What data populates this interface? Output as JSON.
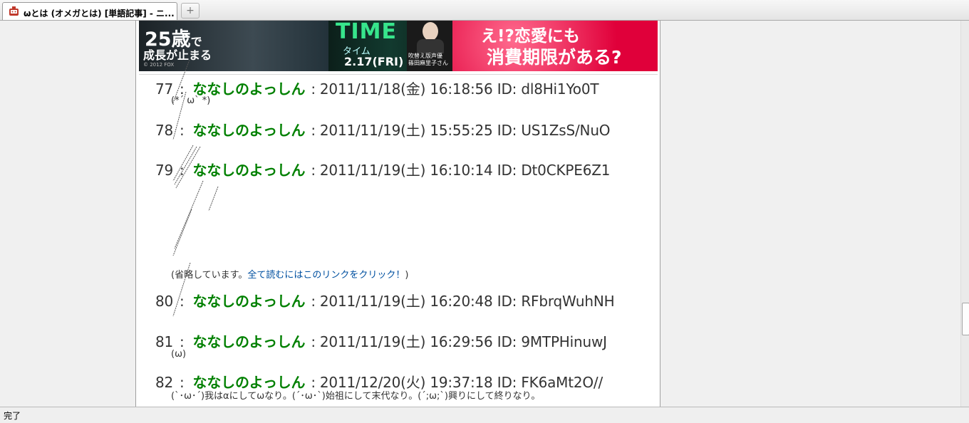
{
  "tab": {
    "title": "ωとは (オメガとは) [単語記事] - ニ..."
  },
  "banner": {
    "age": "25歳",
    "age_suffix": "で",
    "stop": "成長が止まる",
    "copyright": "© 2012 FOX",
    "time": "TIME",
    "taimu": "タイム",
    "date": "2.17(FRI)",
    "voice": [
      "吹替え版声優",
      "篠田麻里子さん"
    ],
    "question1": "え!?恋愛にも",
    "question2": "消費期限がある?"
  },
  "posts": [
    {
      "num": "77",
      "name": "ななしのよっしん",
      "datetime": "2011/11/18(金) 16:18:56",
      "id": "ID: dl8Hi1Yo0T",
      "body": "(*´ ω` *)"
    },
    {
      "num": "78",
      "name": "ななしのよっしん",
      "datetime": "2011/11/19(土) 15:55:25",
      "id": "ID: US1ZsS/NuO",
      "body": ""
    },
    {
      "num": "79",
      "name": "ななしのよっしん",
      "datetime": "2011/11/19(土) 16:10:14",
      "id": "ID: Dt0CKPE6Z1",
      "body_prefix": "(省略しています。",
      "body_link": "全て読むにはこのリンクをクリック！",
      "body_suffix": ")"
    },
    {
      "num": "80",
      "name": "ななしのよっしん",
      "datetime": "2011/11/19(土) 16:20:48",
      "id": "ID: RFbrqWuhNH",
      "body": ""
    },
    {
      "num": "81",
      "name": "ななしのよっしん",
      "datetime": "2011/11/19(土) 16:29:56",
      "id": "ID: 9MTPHinuwJ",
      "body": "(ω)"
    },
    {
      "num": "82",
      "name": "ななしのよっしん",
      "datetime": "2011/12/20(火) 19:37:18",
      "id": "ID: FK6aMt2O//",
      "body": "(`･ω･´)我はαにしてωなり。(´･ω･`)始祖にして末代なり。(´;ω;`)興りにして終りなり。"
    }
  ],
  "status": {
    "text": "完了"
  },
  "colors": {
    "name": "#008000",
    "link": "#0050a0",
    "tab_icon": "#c0392b"
  },
  "icons": {
    "tab": "robot-icon",
    "new_tab": "plus-icon"
  }
}
